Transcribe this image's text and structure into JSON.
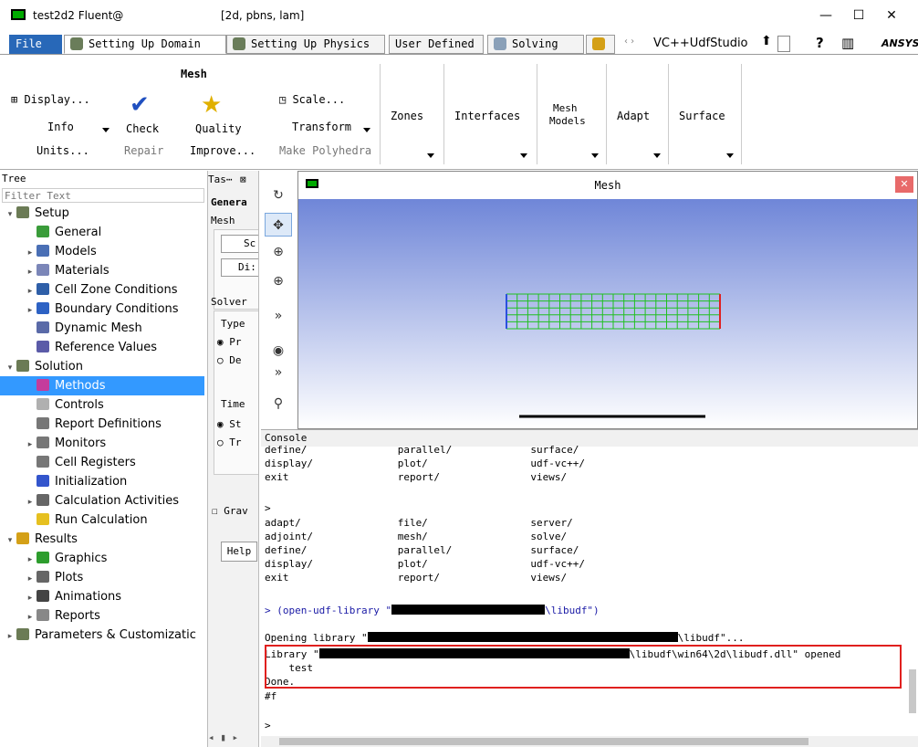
{
  "window": {
    "app_title": "test2d2 Fluent@",
    "info": "[2d, pbns, lam]",
    "controls": {
      "minimize": "—",
      "maximize": "☐",
      "close": "✕"
    }
  },
  "tabs": {
    "file": "File",
    "items": [
      "Setting Up Domain",
      "Setting Up Physics",
      "User Defined",
      "Solving"
    ],
    "vc_label": "VC++UdfStudio",
    "brand": "ANSYS"
  },
  "ribbon": {
    "mesh_group": "Mesh",
    "display": "Display...",
    "info": "Info",
    "units": "Units...",
    "check": "Check",
    "repair": "Repair",
    "quality": "Quality",
    "improve": "Improve...",
    "scale": "Scale...",
    "transform": "Transform",
    "make_polyhedra": "Make Polyhedra",
    "zones": "Zones",
    "interfaces": "Interfaces",
    "mesh_models_1": "Mesh",
    "mesh_models_2": "Models",
    "adapt": "Adapt",
    "surface": "Surface"
  },
  "tree": {
    "header": "Tree",
    "filter_placeholder": "Filter Text",
    "items": [
      {
        "label": "Setup",
        "level": 0,
        "expand": "▾",
        "icon": "setup-icon",
        "color": "#6b7b55"
      },
      {
        "label": "General",
        "level": 1,
        "expand": "",
        "icon": "general-icon",
        "color": "#3a9c3a"
      },
      {
        "label": "Models",
        "level": 1,
        "expand": "▸",
        "icon": "models-icon",
        "color": "#4a6fb5"
      },
      {
        "label": "Materials",
        "level": 1,
        "expand": "▸",
        "icon": "materials-icon",
        "color": "#7b86b8"
      },
      {
        "label": "Cell Zone Conditions",
        "level": 1,
        "expand": "▸",
        "icon": "cell-zone-icon",
        "color": "#2f5fa8"
      },
      {
        "label": "Boundary Conditions",
        "level": 1,
        "expand": "▸",
        "icon": "boundary-icon",
        "color": "#2d62c4"
      },
      {
        "label": "Dynamic Mesh",
        "level": 1,
        "expand": "",
        "icon": "dynamic-mesh-icon",
        "color": "#5a6aa8"
      },
      {
        "label": "Reference Values",
        "level": 1,
        "expand": "",
        "icon": "reference-values-icon",
        "color": "#5b5ba8"
      },
      {
        "label": "Solution",
        "level": 0,
        "expand": "▾",
        "icon": "solution-icon",
        "color": "#6b7b55"
      },
      {
        "label": "Methods",
        "level": 1,
        "expand": "",
        "icon": "methods-icon",
        "color": "#c43c9c"
      },
      {
        "label": "Controls",
        "level": 1,
        "expand": "",
        "icon": "controls-icon",
        "color": "#b0b0b0"
      },
      {
        "label": "Report Definitions",
        "level": 1,
        "expand": "",
        "icon": "report-definitions-icon",
        "color": "#777777"
      },
      {
        "label": "Monitors",
        "level": 1,
        "expand": "▸",
        "icon": "monitors-icon",
        "color": "#777777"
      },
      {
        "label": "Cell Registers",
        "level": 1,
        "expand": "",
        "icon": "cell-registers-icon",
        "color": "#777777"
      },
      {
        "label": "Initialization",
        "level": 1,
        "expand": "",
        "icon": "initialization-icon",
        "color": "#3355cc"
      },
      {
        "label": "Calculation Activities",
        "level": 1,
        "expand": "▸",
        "icon": "calc-activities-icon",
        "color": "#666666"
      },
      {
        "label": "Run Calculation",
        "level": 1,
        "expand": "",
        "icon": "run-calc-icon",
        "color": "#e6c020"
      },
      {
        "label": "Results",
        "level": 0,
        "expand": "▾",
        "icon": "results-icon",
        "color": "#d4a017"
      },
      {
        "label": "Graphics",
        "level": 1,
        "expand": "▸",
        "icon": "graphics-icon",
        "color": "#2d9d2d"
      },
      {
        "label": "Plots",
        "level": 1,
        "expand": "▸",
        "icon": "plots-icon",
        "color": "#666666"
      },
      {
        "label": "Animations",
        "level": 1,
        "expand": "▸",
        "icon": "animations-icon",
        "color": "#444444"
      },
      {
        "label": "Reports",
        "level": 1,
        "expand": "▸",
        "icon": "reports-icon",
        "color": "#888888"
      },
      {
        "label": "Parameters & Customizatic",
        "level": 0,
        "expand": "▸",
        "icon": "parameters-icon",
        "color": "#6b7b55"
      }
    ]
  },
  "task": {
    "header": "Tas⋯",
    "close": "⊠",
    "general": "Genera",
    "mesh": "Mesh",
    "btn_scale": "Sc",
    "btn_display": "Di:",
    "solver": "Solver",
    "type": "Type",
    "pressure": "Pr",
    "density": "De",
    "time": "Time",
    "steady": "St",
    "transient": "Tr",
    "gravity": "Grav",
    "help": "Help"
  },
  "mesh_window": {
    "title": "Mesh",
    "close": "✕"
  },
  "console": {
    "title": "Console",
    "lines": [
      "define/               parallel/             surface/",
      "display/              plot/                 udf-vc++/",
      "exit                  report/               views/",
      "",
      ">",
      "adapt/                file/                 server/",
      "adjoint/              mesh/                 solve/",
      "define/               parallel/             surface/",
      "display/              plot/                 udf-vc++/",
      "exit                  report/               views/"
    ],
    "cmd_prefix": "> (open-udf-library \"",
    "cmd_suffix": "\\libudf\")",
    "opening_prefix": "Opening library \"",
    "opening_suffix": "\\libudf\"...",
    "library_prefix": "Library \"",
    "library_suffix": "\\libudf\\win64\\2d\\libudf.dll\" opened",
    "test": "    test",
    "done": "Done.",
    "result": "#f",
    "prompt": ">"
  }
}
